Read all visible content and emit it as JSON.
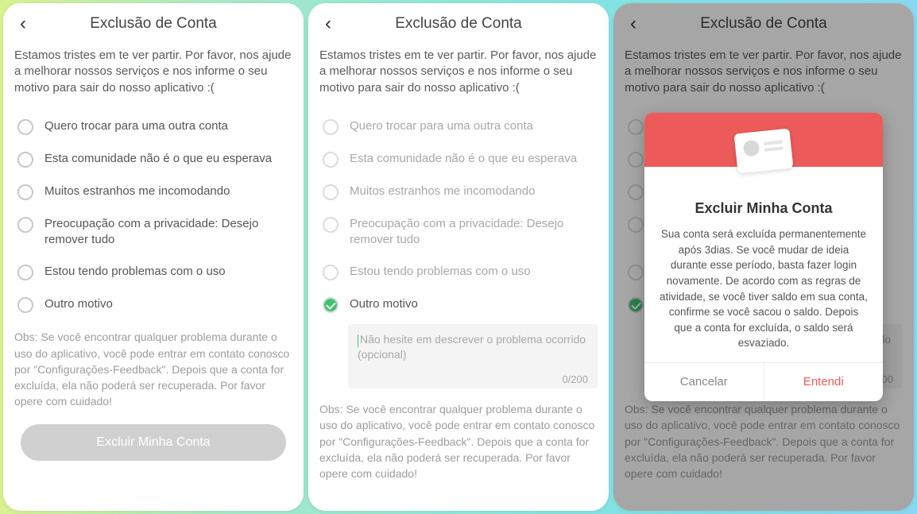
{
  "header": {
    "title": "Exclusão de Conta"
  },
  "intro": "Estamos tristes em te ver partir. Por favor, nos ajude a melhorar nossos serviços e nos informe o seu motivo para sair do nosso aplicativo :(",
  "options": [
    "Quero trocar para uma outra conta",
    "Esta comunidade não é o que eu esperava",
    "Muitos estranhos me incomodando",
    "Preocupação com a privacidade: Desejo remover tudo",
    "Estou tendo problemas com o uso",
    "Outro motivo"
  ],
  "textarea": {
    "placeholder": "Não hesite em descrever o problema ocorrido (opcional)",
    "counter": "0/200"
  },
  "note": "Obs: Se você encontrar qualquer problema durante o uso do aplicativo, você pode entrar em contato conosco por \"Configurações-Feedback\". Depois que a conta for excluída, ela não poderá ser recuperada. Por favor opere com cuidado!",
  "deleteButton": "Excluir Minha Conta",
  "dialog": {
    "title": "Excluir Minha Conta",
    "body": "Sua conta será excluída permanentemente após 3dias. Se você mudar de ideia durante esse período, basta fazer login novamente. De acordo com as regras de atividade, se você tiver saldo em sua conta, confirme se você sacou o saldo. Depois que a conta for excluída, o saldo será esvaziado.",
    "cancel": "Cancelar",
    "ok": "Entendi"
  }
}
